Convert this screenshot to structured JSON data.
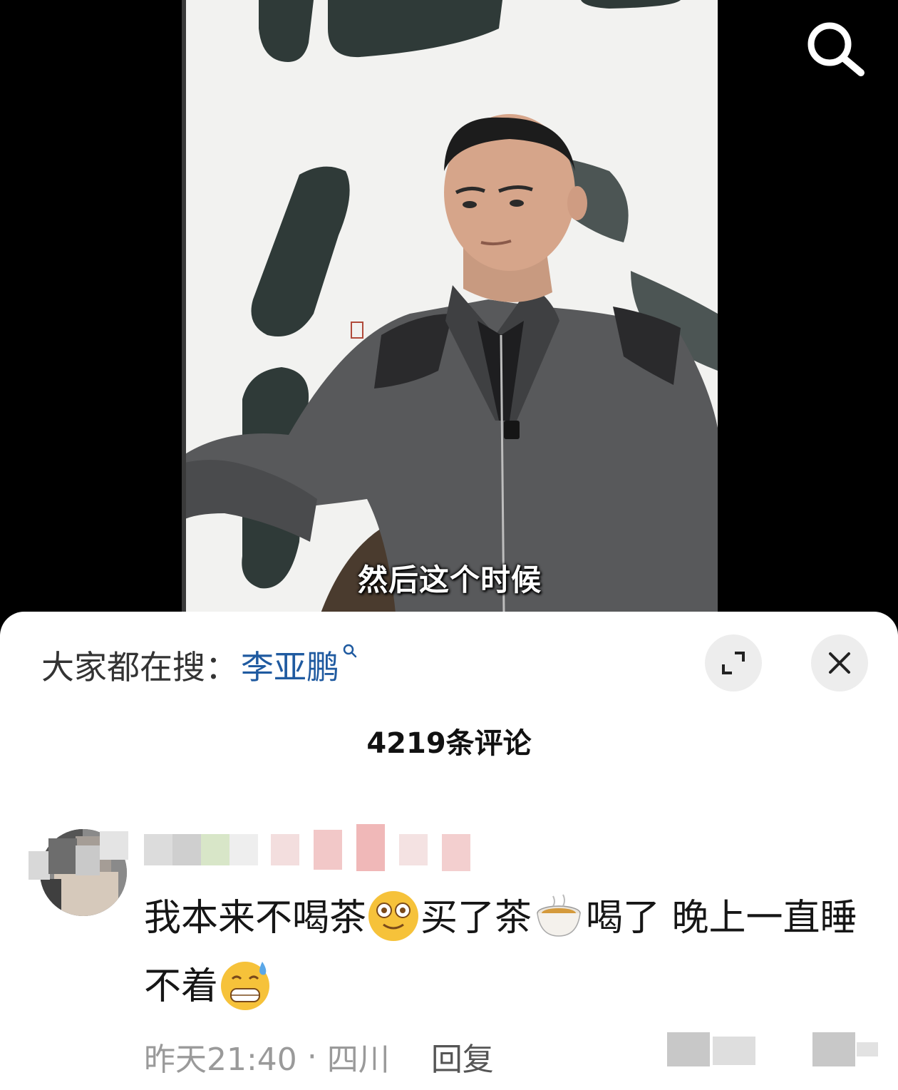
{
  "video": {
    "subtitle": "然后这个时候",
    "search_icon": "search-icon"
  },
  "sheet": {
    "trending_prefix": "大家都在搜：",
    "trending_keyword": "李亚鹏",
    "expand_icon": "expand-icon",
    "close_icon": "close-icon",
    "comment_count": "4219条评论"
  },
  "comment": {
    "segments": {
      "t1": "我本来不喝茶",
      "e1": "dizzy-smile-emoji",
      "t2": "买了茶",
      "e2": "tea-cup-emoji",
      "t3": "喝了 晚上一直睡不着",
      "e3": "sweat-grin-emoji"
    },
    "time": "昨天21:40",
    "location": "四川",
    "reply_label": "回复"
  }
}
